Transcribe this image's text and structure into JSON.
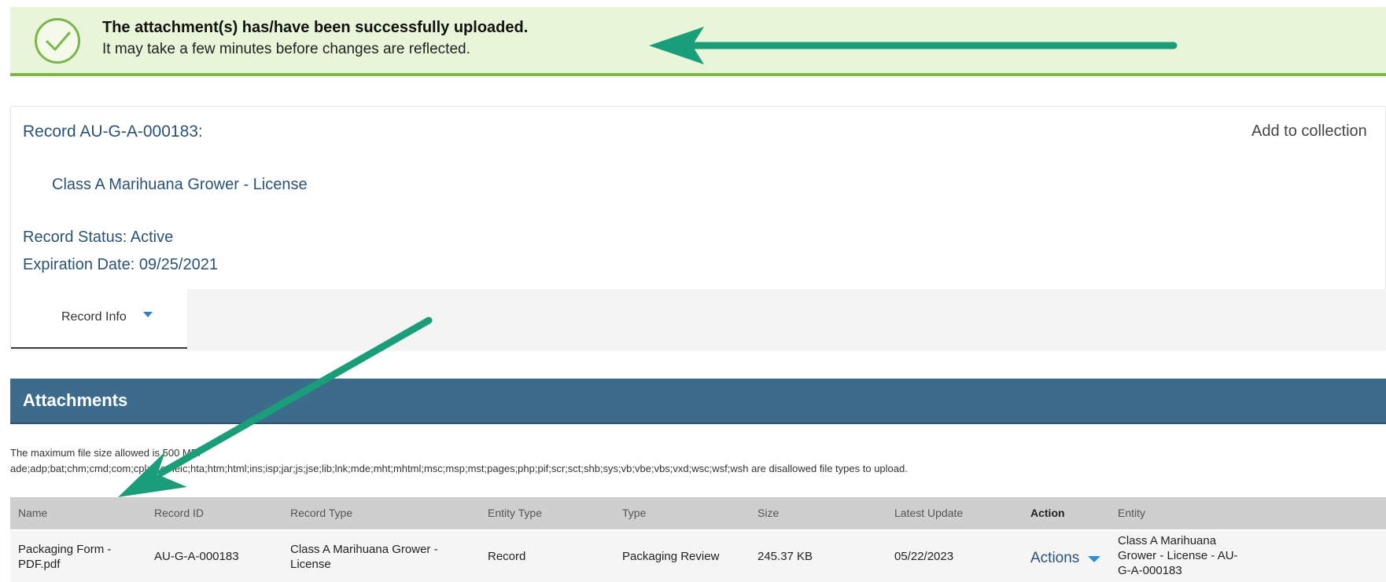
{
  "banner": {
    "title": "The attachment(s) has/have been successfully uploaded.",
    "subtitle": "It may take a few minutes before changes are reflected."
  },
  "record": {
    "title": "Record AU-G-A-000183:",
    "type": "Class A Marihuana Grower - License",
    "status": "Record Status: Active",
    "expiration": "Expiration Date: 09/25/2021",
    "add_to_collection": "Add to collection",
    "tab_record_info": "Record Info"
  },
  "attachments": {
    "heading": "Attachments",
    "max_size_note": "The maximum file size allowed is 500 MB.",
    "disallowed_note": "ade;adp;bat;chm;cmd;com;cpl;exe;heic;hta;htm;html;ins;isp;jar;js;jse;lib;lnk;mde;mht;mhtml;msc;msp;mst;pages;php;pif;scr;sct;shb;sys;vb;vbe;vbs;vxd;wsc;wsf;wsh are disallowed file types to upload.",
    "columns": [
      "Name",
      "Record ID",
      "Record Type",
      "Entity Type",
      "Type",
      "Size",
      "Latest Update",
      "Action",
      "Entity"
    ],
    "rows": [
      {
        "name_line1": "Packaging Form -",
        "name_line2": "PDF.pdf",
        "record_id": "AU-G-A-000183",
        "record_type_line1": "Class A Marihuana Grower -",
        "record_type_line2": "License",
        "entity_type": "Record",
        "type": "Packaging Review",
        "size": "245.37 KB",
        "latest_update": "05/22/2023",
        "action": "Actions",
        "entity_line1": "Class A Marihuana",
        "entity_line2": "Grower - License - AU-",
        "entity_line3": "G-A-000183"
      }
    ]
  },
  "colors": {
    "banner_bg": "#e8f5d9",
    "banner_accent": "#7ab648",
    "header_blue": "#3d6b8b",
    "text_blue": "#2a5373",
    "arrow_teal": "#1a9e7a"
  }
}
